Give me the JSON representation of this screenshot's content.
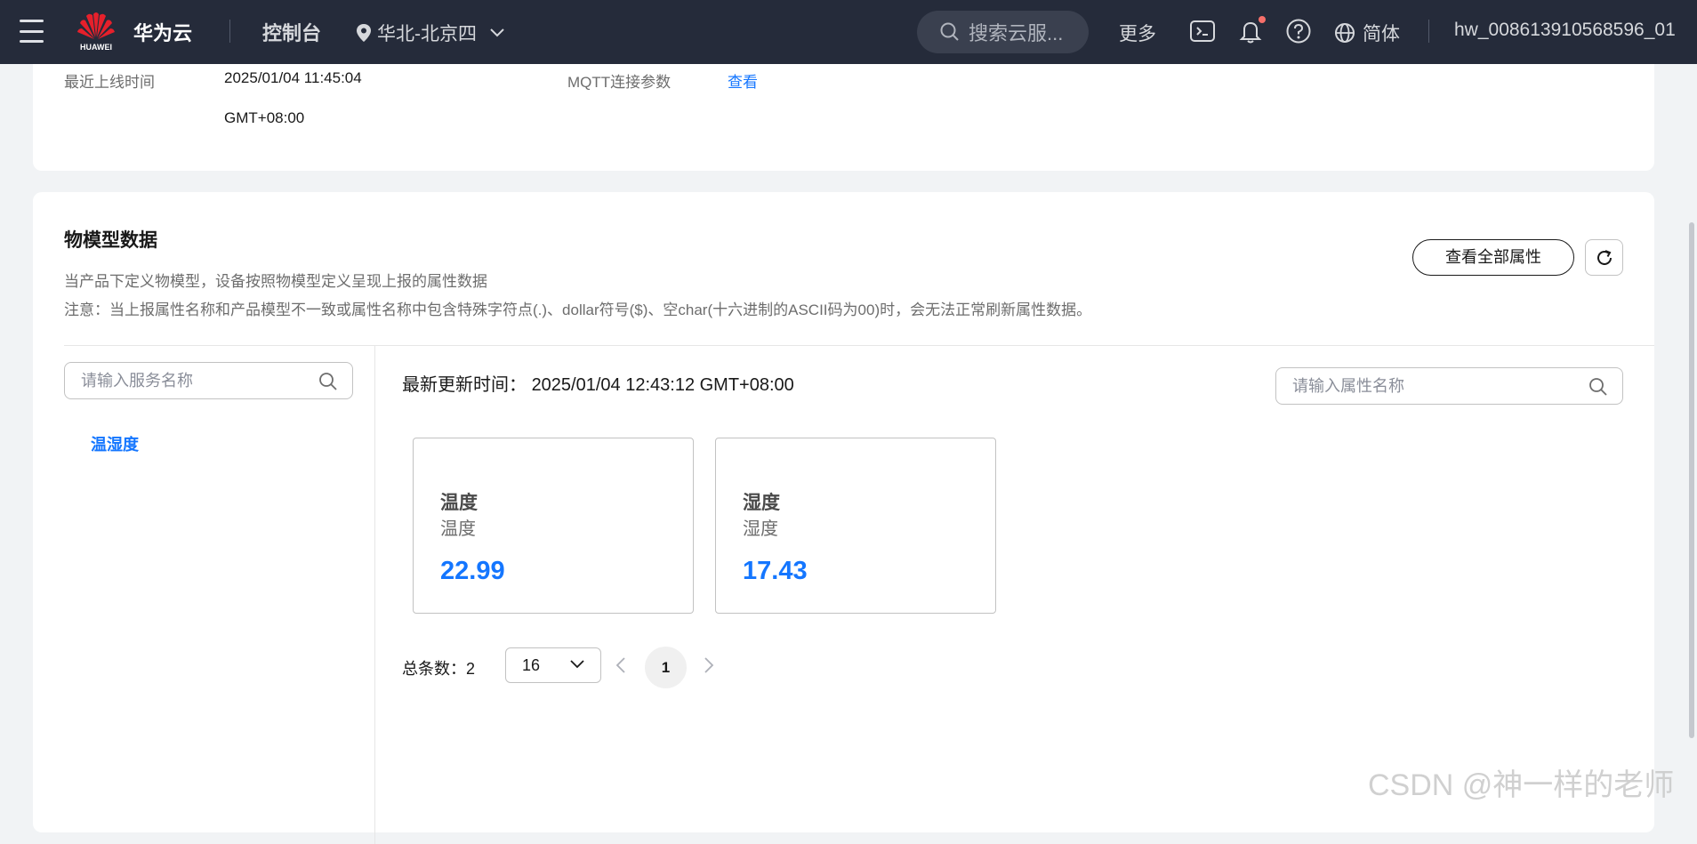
{
  "topbar": {
    "logo_text": "HUAWEI",
    "brand": "华为云",
    "console": "控制台",
    "region": "华北-北京四",
    "search_placeholder": "搜索云服...",
    "more": "更多",
    "language": "简体",
    "username": "hw_008613910568596_01",
    "icons": [
      "menu-icon",
      "location-icon",
      "chevron-down-icon",
      "search-icon",
      "terminal-icon",
      "bell-icon",
      "help-icon",
      "globe-icon"
    ]
  },
  "device_info": {
    "last_online_label": "最近上线时间",
    "last_online_value": "2025/01/04 11:45:04",
    "last_online_tz": "GMT+08:00",
    "mqtt_label": "MQTT连接参数",
    "mqtt_link": "查看"
  },
  "model_data": {
    "title": "物模型数据",
    "desc1": "当产品下定义物模型，设备按照物模型定义呈现上报的属性数据",
    "desc2": "注意：当上报属性名称和产品模型不一致或属性名称中包含特殊字符点(.)、dollar符号($)、空char(十六进制的ASCII码为00)时，会无法正常刷新属性数据。",
    "view_all_button": "查看全部属性",
    "service_search_placeholder": "请输入服务名称",
    "services": [
      "温湿度"
    ],
    "update_label": "最新更新时间：",
    "update_value": "2025/01/04 12:43:12 GMT+08:00",
    "property_search_placeholder": "请输入属性名称",
    "properties": [
      {
        "name": "温度",
        "desc": "温度",
        "value": "22.99"
      },
      {
        "name": "湿度",
        "desc": "湿度",
        "value": "17.43"
      }
    ],
    "pagination": {
      "total_label": "总条数：2",
      "page_size": "16",
      "current_page": "1"
    }
  },
  "watermark": "CSDN @神一样的老师",
  "colors": {
    "topbar": "#252b3a",
    "accent": "#1476ff",
    "background": "#f1f3f5"
  }
}
